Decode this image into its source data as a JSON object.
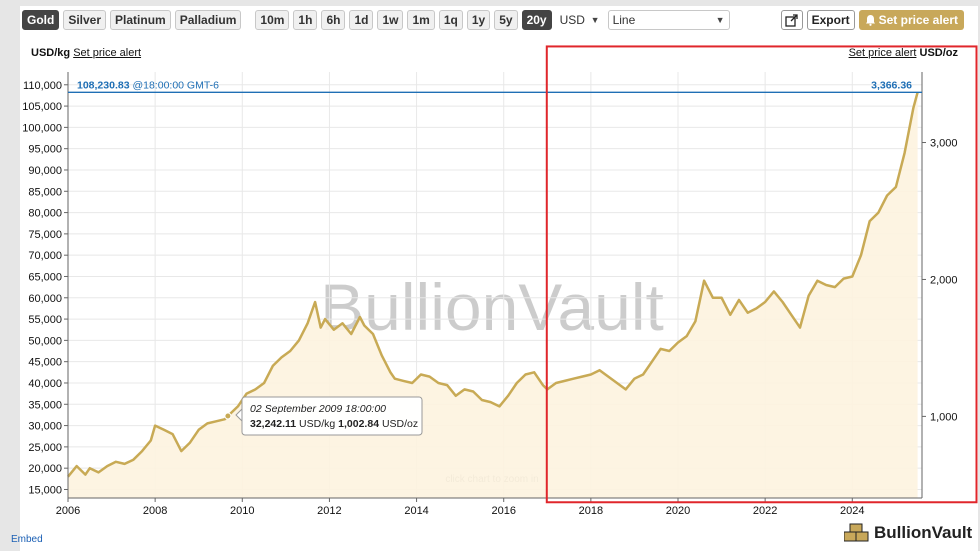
{
  "toolbar": {
    "metals": [
      {
        "label": "Gold",
        "active": true
      },
      {
        "label": "Silver",
        "active": false
      },
      {
        "label": "Platinum",
        "active": false
      },
      {
        "label": "Palladium",
        "active": false
      }
    ],
    "ranges": [
      {
        "label": "10m",
        "active": false
      },
      {
        "label": "1h",
        "active": false
      },
      {
        "label": "6h",
        "active": false
      },
      {
        "label": "1d",
        "active": false
      },
      {
        "label": "1w",
        "active": false
      },
      {
        "label": "1m",
        "active": false
      },
      {
        "label": "1q",
        "active": false
      },
      {
        "label": "1y",
        "active": false
      },
      {
        "label": "5y",
        "active": false
      },
      {
        "label": "20y",
        "active": true
      }
    ],
    "currency": "USD",
    "chart_style": "Line",
    "export_label": "Export",
    "alert_label": "Set price alert"
  },
  "units": {
    "left_unit": "USD/kg",
    "left_link": "Set price alert",
    "right_link": "Set price alert",
    "right_unit": "USD/oz"
  },
  "current_price": {
    "kg_value": "108,230.83",
    "time": "@18:00:00 GMT-6",
    "oz_value": "3,366.36"
  },
  "tooltip": {
    "date": "02 September 2009 18:00:00",
    "kg_value": "32,242.11",
    "kg_unit": "USD/kg",
    "oz_value": "1,002.84",
    "oz_unit": "USD/oz"
  },
  "watermark": "BullionVault",
  "zoom_hint": "click chart to zoom in",
  "embed_label": "Embed",
  "logo_text": "BullionVault",
  "colors": {
    "line": "#c8aa55",
    "fill": "#fdf3df",
    "current_line": "#1f6fb5",
    "highlight_box": "#e0262b",
    "active_button": "#444444",
    "alert_button": "#c8a85a"
  },
  "chart_data": {
    "type": "area",
    "title": "",
    "xlabel": "",
    "ylabel": "USD/kg",
    "y2label": "USD/oz",
    "xlim": [
      2006.0,
      2025.6
    ],
    "ylim": [
      13000,
      113000
    ],
    "y2lim": [
      404,
      3515
    ],
    "x_ticks": [
      "2006",
      "2008",
      "2010",
      "2012",
      "2014",
      "2016",
      "2018",
      "2020",
      "2022",
      "2024"
    ],
    "y_ticks": [
      15000,
      20000,
      25000,
      30000,
      35000,
      40000,
      45000,
      50000,
      55000,
      60000,
      65000,
      70000,
      75000,
      80000,
      85000,
      90000,
      95000,
      100000,
      105000,
      110000
    ],
    "y_tick_labels": [
      "15,000",
      "20,000",
      "25,000",
      "30,000",
      "35,000",
      "40,000",
      "45,000",
      "50,000",
      "55,000",
      "60,000",
      "65,000",
      "70,000",
      "75,000",
      "80,000",
      "85,000",
      "90,000",
      "95,000",
      "100,000",
      "105,000",
      "110,000"
    ],
    "y2_ticks": [
      1000,
      2000,
      3000
    ],
    "y2_tick_labels": [
      "1,000",
      "2,000",
      "3,000"
    ],
    "current_value": 108230.83,
    "highlight_range": {
      "x": [
        2017.0,
        2025.6
      ],
      "y": [
        12000,
        119000
      ]
    },
    "tooltip_point": {
      "x": 2009.67,
      "y": 32242.11
    },
    "series": [
      {
        "name": "Gold",
        "x": [
          2006.0,
          2006.2,
          2006.4,
          2006.5,
          2006.7,
          2006.9,
          2007.1,
          2007.3,
          2007.5,
          2007.7,
          2007.9,
          2008.0,
          2008.2,
          2008.4,
          2008.6,
          2008.8,
          2009.0,
          2009.2,
          2009.4,
          2009.6,
          2009.67,
          2009.9,
          2010.1,
          2010.3,
          2010.5,
          2010.7,
          2010.9,
          2011.1,
          2011.3,
          2011.5,
          2011.67,
          2011.8,
          2011.9,
          2012.1,
          2012.3,
          2012.5,
          2012.7,
          2012.8,
          2013.0,
          2013.2,
          2013.4,
          2013.5,
          2013.7,
          2013.9,
          2014.1,
          2014.3,
          2014.5,
          2014.7,
          2014.9,
          2015.1,
          2015.3,
          2015.5,
          2015.7,
          2015.9,
          2016.1,
          2016.3,
          2016.5,
          2016.7,
          2016.9,
          2017.0,
          2017.2,
          2017.4,
          2017.6,
          2017.8,
          2018.0,
          2018.2,
          2018.4,
          2018.6,
          2018.8,
          2019.0,
          2019.2,
          2019.4,
          2019.6,
          2019.8,
          2020.0,
          2020.2,
          2020.4,
          2020.6,
          2020.8,
          2021.0,
          2021.2,
          2021.4,
          2021.6,
          2021.8,
          2022.0,
          2022.2,
          2022.4,
          2022.6,
          2022.8,
          2023.0,
          2023.2,
          2023.4,
          2023.6,
          2023.8,
          2024.0,
          2024.2,
          2024.4,
          2024.6,
          2024.8,
          2025.0,
          2025.2,
          2025.4,
          2025.5
        ],
        "y": [
          18000,
          20500,
          18500,
          20000,
          19000,
          20500,
          21500,
          21000,
          22000,
          24000,
          26500,
          30000,
          29000,
          28000,
          24000,
          26000,
          29000,
          30500,
          31000,
          31500,
          32242,
          34500,
          37500,
          38500,
          40000,
          44000,
          46000,
          47500,
          50000,
          54000,
          59000,
          53000,
          55000,
          52500,
          54000,
          51500,
          55500,
          53500,
          51500,
          46500,
          42500,
          41000,
          40500,
          40000,
          42000,
          41500,
          40000,
          39500,
          37000,
          38500,
          38000,
          36000,
          35500,
          34500,
          37000,
          40000,
          42000,
          42500,
          39500,
          38500,
          40000,
          40500,
          41000,
          41500,
          42000,
          43000,
          41500,
          40000,
          38500,
          41000,
          42000,
          45000,
          48000,
          47500,
          49500,
          51000,
          54500,
          64000,
          60000,
          60000,
          56000,
          59500,
          56500,
          57500,
          59000,
          61500,
          59000,
          56000,
          53000,
          60500,
          64000,
          63000,
          62500,
          64500,
          65000,
          70000,
          78000,
          80000,
          84000,
          86000,
          94000,
          104500,
          108230
        ]
      }
    ]
  }
}
